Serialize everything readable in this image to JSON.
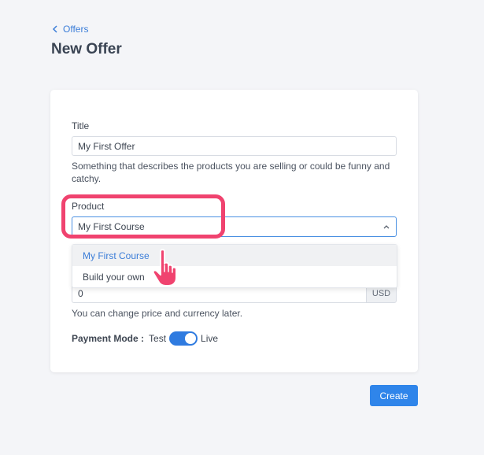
{
  "breadcrumb": {
    "label": "Offers"
  },
  "page": {
    "title": "New Offer"
  },
  "form": {
    "title_label": "Title",
    "title_value": "My First Offer",
    "title_help": "Something that describes the products you are selling or could be funny and catchy.",
    "product_label": "Product",
    "product_value": "My First Course",
    "product_options": [
      "My First Course",
      "Build your own"
    ],
    "price_value": "0",
    "currency": "USD",
    "price_help": "You can change price and currency later.",
    "payment_mode_label": "Payment Mode :",
    "payment_mode_left": "Test",
    "payment_mode_right": "Live",
    "payment_mode_live": true
  },
  "actions": {
    "create_label": "Create"
  },
  "colors": {
    "accent": "#2f85ea",
    "highlight": "#f0436f",
    "pointer": "#f0436f"
  }
}
